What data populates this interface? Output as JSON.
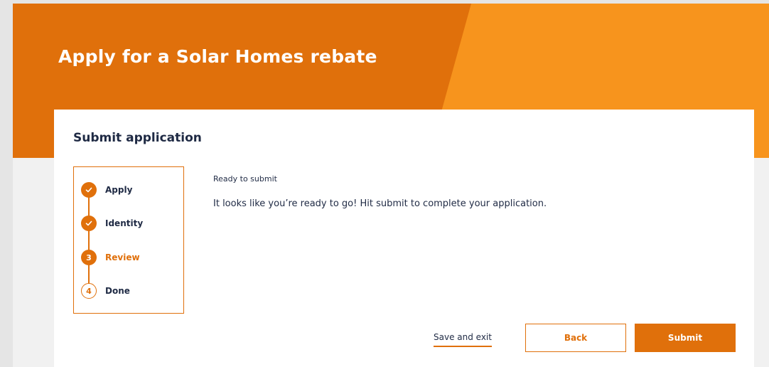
{
  "header": {
    "title": "Apply for a Solar Homes rebate"
  },
  "card": {
    "title": "Submit application",
    "steps": [
      {
        "number": "1",
        "label": "Apply",
        "state": "done",
        "icon": "check-icon"
      },
      {
        "number": "2",
        "label": "Identity",
        "state": "done",
        "icon": "check-icon"
      },
      {
        "number": "3",
        "label": "Review",
        "state": "current"
      },
      {
        "number": "4",
        "label": "Done",
        "state": "todo"
      }
    ],
    "content": {
      "heading": "Ready to submit",
      "body": "It looks like you’re ready to go! Hit submit to complete your application."
    },
    "actions": {
      "save_exit": "Save and exit",
      "back": "Back",
      "submit": "Submit"
    }
  },
  "colors": {
    "accent": "#e0700b",
    "accent_light": "#f7941d",
    "text": "#1f2a44"
  }
}
